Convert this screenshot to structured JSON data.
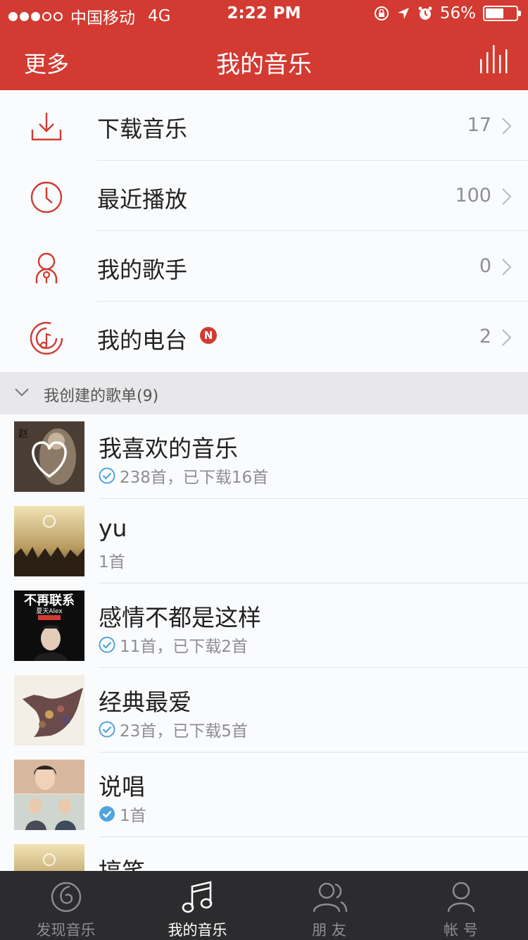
{
  "status_bar": {
    "carrier": "中国移动",
    "network": "4G",
    "time": "2:22 PM",
    "battery": "56%",
    "battery_level": 0.56
  },
  "nav": {
    "left": "更多",
    "title": "我的音乐"
  },
  "menu": [
    {
      "label": "下载音乐",
      "count": "17",
      "icon": "download-icon"
    },
    {
      "label": "最近播放",
      "count": "100",
      "icon": "clock-icon"
    },
    {
      "label": "我的歌手",
      "count": "0",
      "icon": "singer-icon"
    },
    {
      "label": "我的电台",
      "count": "2",
      "icon": "radio-icon",
      "badge": "N"
    }
  ],
  "section": {
    "label": "我创建的歌单(9)"
  },
  "playlists": [
    {
      "title": "我喜欢的音乐",
      "meta": "238首，已下载16首",
      "downloaded": true
    },
    {
      "title": "yu",
      "meta": "1首",
      "downloaded": false
    },
    {
      "title": "感情不都是这样",
      "meta": "11首，已下载2首",
      "downloaded": true,
      "cover_text": "不再联系",
      "cover_sub": "夏天Alex"
    },
    {
      "title": "经典最爱",
      "meta": "23首，已下载5首",
      "downloaded": true
    },
    {
      "title": "说唱",
      "meta": "1首",
      "downloaded": true
    },
    {
      "title": "搞笑",
      "meta": "",
      "downloaded": false
    }
  ],
  "tabs": [
    {
      "label": "发现音乐",
      "icon": "discover-icon",
      "active": false
    },
    {
      "label": "我的音乐",
      "icon": "music-note-icon",
      "active": true
    },
    {
      "label": "朋 友",
      "icon": "friends-icon",
      "active": false
    },
    {
      "label": "帐 号",
      "icon": "account-icon",
      "active": false
    }
  ],
  "colors": {
    "brand": "#d33a31",
    "check": "#4fa4de",
    "tabbar": "#2c2c2e"
  }
}
